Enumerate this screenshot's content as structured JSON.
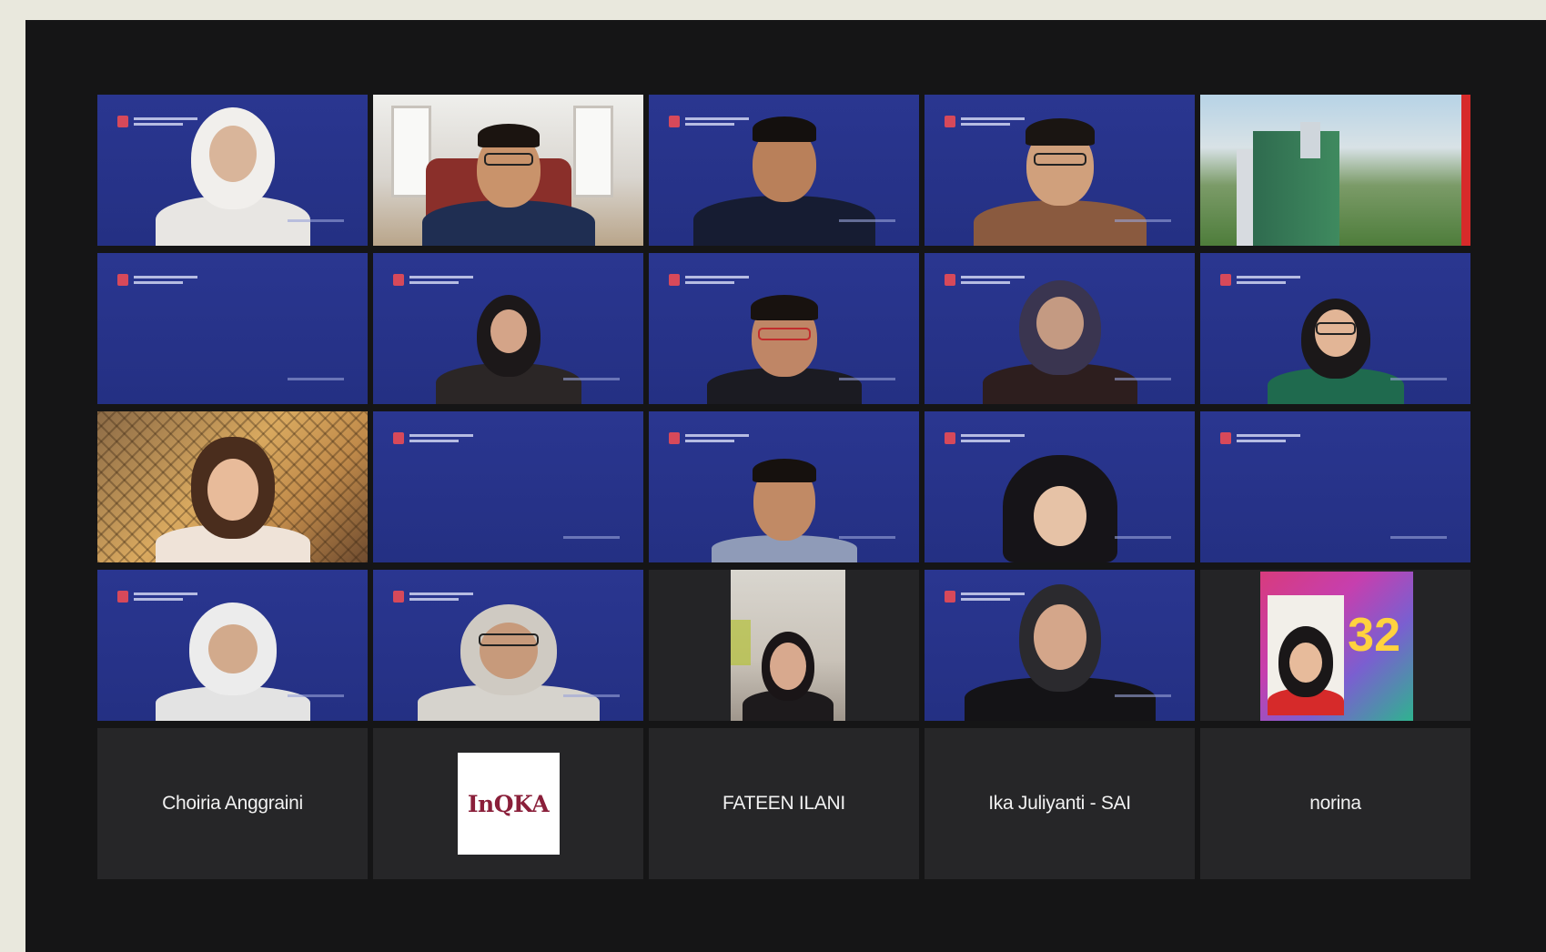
{
  "meeting": {
    "participant_names": [
      "Choiria Anggraini",
      "FATEEN ILANI",
      "Ika Juliyanti - SAI",
      "norina"
    ],
    "inqka_logo_text": "InQKA"
  },
  "colors": {
    "virtual_background": "#26338a",
    "tile_dark": "#242426",
    "screen_background": "#151516"
  },
  "icons": {
    "poster_number": "32"
  }
}
